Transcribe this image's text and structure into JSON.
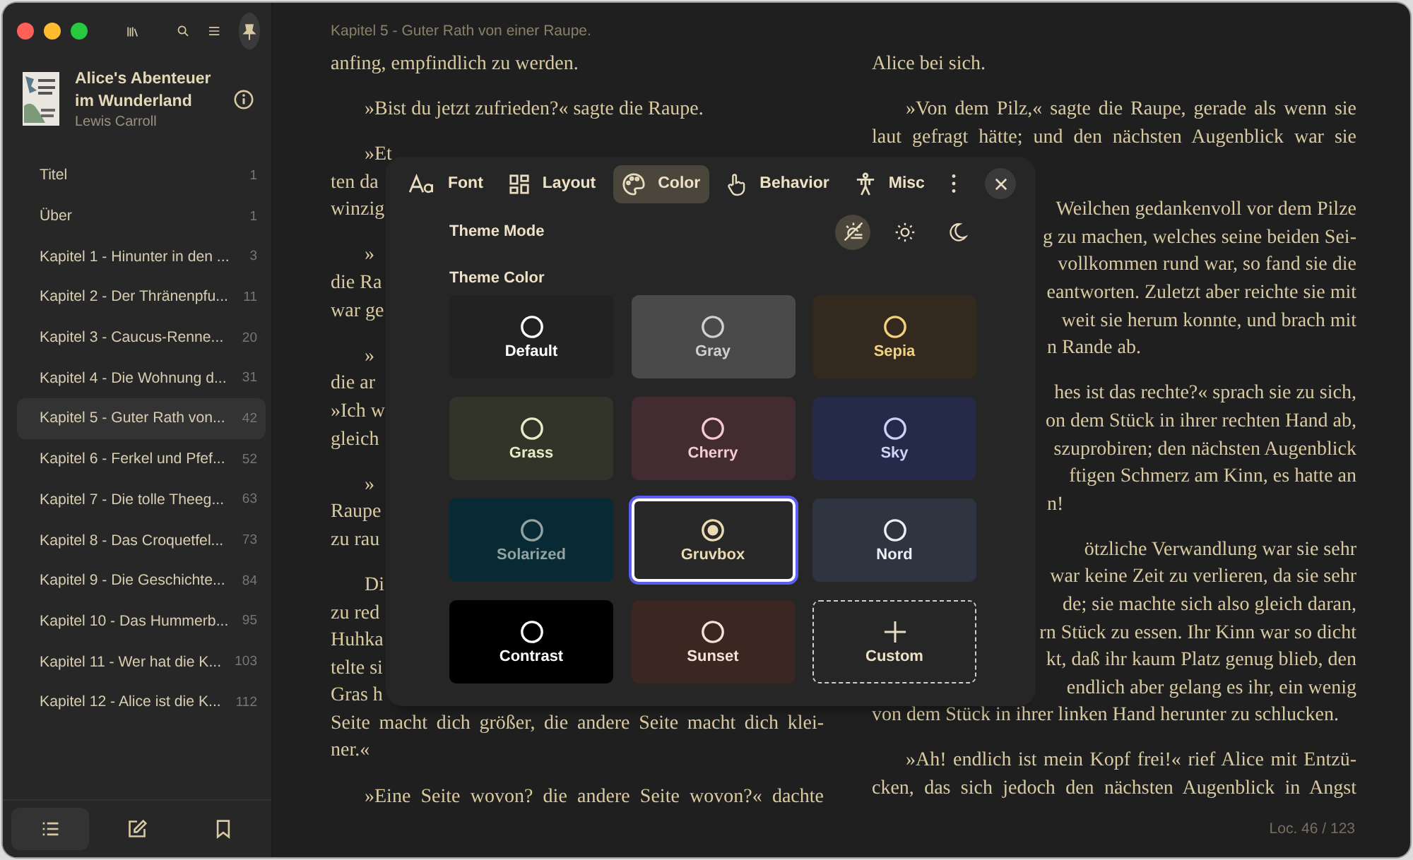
{
  "sidebar": {
    "pinned": true,
    "book": {
      "title": "Alice's Abenteuer im Wunderland",
      "author": "Lewis Carroll"
    },
    "toc": [
      {
        "label": "Titel",
        "page": "1",
        "selected": false
      },
      {
        "label": "Über",
        "page": "1",
        "selected": false
      },
      {
        "label": "Kapitel 1 - Hinunter in den ...",
        "page": "3",
        "selected": false
      },
      {
        "label": "Kapitel 2 - Der Thränenpfu...",
        "page": "11",
        "selected": false
      },
      {
        "label": "Kapitel 3 - Caucus-Renne...",
        "page": "20",
        "selected": false
      },
      {
        "label": "Kapitel 4 - Die Wohnung d...",
        "page": "31",
        "selected": false
      },
      {
        "label": "Kapitel 5 - Guter Rath von...",
        "page": "42",
        "selected": true
      },
      {
        "label": "Kapitel 6 - Ferkel und Pfef...",
        "page": "52",
        "selected": false
      },
      {
        "label": "Kapitel 7 - Die tolle Theeg...",
        "page": "63",
        "selected": false
      },
      {
        "label": "Kapitel 8 - Das Croquetfel...",
        "page": "73",
        "selected": false
      },
      {
        "label": "Kapitel 9 - Die Geschichte...",
        "page": "84",
        "selected": false
      },
      {
        "label": "Kapitel 10 - Das Hummerb...",
        "page": "95",
        "selected": false
      },
      {
        "label": "Kapitel 11 - Wer hat die K...",
        "page": "103",
        "selected": false
      },
      {
        "label": "Kapitel 12 - Alice ist die K...",
        "page": "112",
        "selected": false
      }
    ],
    "bottom_tabs": [
      {
        "kind": "toc",
        "selected": true
      },
      {
        "kind": "notes",
        "selected": false
      },
      {
        "kind": "bookmarks",
        "selected": false
      }
    ]
  },
  "reader": {
    "chapter": "Kapitel 5 - Guter Rath von einer Raupe.",
    "location": "Loc. 46 / 123",
    "columns": [
      {
        "paragraphs": [
          {
            "lines": [
              {
                "kind": "plain",
                "text": "anfing, empfindlich zu werden."
              }
            ]
          },
          {
            "lines": [
              {
                "kind": "indent",
                "text": "»Bist du jetzt zufrieden?« sagte die Raupe."
              }
            ]
          },
          {
            "lines": [
              {
                "kind": "indent",
                "text": "»Et"
              },
              {
                "kind": "plain",
                "text": "ten da"
              },
              {
                "kind": "plain",
                "text": "winzig"
              }
            ]
          },
          {
            "lines": [
              {
                "kind": "indent",
                "text": "»"
              },
              {
                "kind": "plain",
                "text": "die Ra"
              },
              {
                "kind": "plain",
                "text": "war ge"
              }
            ]
          },
          {
            "lines": [
              {
                "kind": "indent",
                "text": "»"
              },
              {
                "kind": "plain",
                "text": "die ar"
              },
              {
                "kind": "plain",
                "text": "»Ich w"
              },
              {
                "kind": "plain",
                "text": "gleich"
              }
            ]
          },
          {
            "lines": [
              {
                "kind": "indent",
                "text": "»"
              },
              {
                "kind": "plain",
                "text": "Raupe"
              },
              {
                "kind": "plain",
                "text": "zu rau"
              }
            ]
          },
          {
            "lines": [
              {
                "kind": "indent",
                "text": "Di"
              },
              {
                "kind": "plain",
                "text": "zu red"
              },
              {
                "kind": "plain",
                "text": "Huhka"
              },
              {
                "kind": "plain",
                "text": "telte si"
              },
              {
                "kind": "plain",
                "text": "Gras h"
              },
              {
                "kind": "justified",
                "text": "Seite macht dich größer, die andere Seite macht dich klei-"
              },
              {
                "kind": "plain",
                "text": "ner.«"
              }
            ]
          },
          {
            "lines": [
              {
                "kind": "indent_justified",
                "text": "»Eine Seite wovon? die andere Seite wovon?« dachte"
              }
            ]
          }
        ]
      },
      {
        "paragraphs": [
          {
            "lines": [
              {
                "kind": "plain",
                "text": "Alice bei sich."
              }
            ]
          },
          {
            "lines": [
              {
                "kind": "indent_justified",
                "text": "»Von dem Pilz,« sagte die Raupe, gerade als wenn sie"
              },
              {
                "kind": "justified",
                "text": "laut gefragt hätte; und den nächsten Augenblick war sie"
              }
            ]
          },
          {
            "lines": [
              {
                "kind": "right",
                "text": "Weilchen gedankenvoll vor dem Pilze"
              },
              {
                "kind": "right",
                "text": "g zu machen, welches seine beiden Sei-"
              },
              {
                "kind": "right",
                "text": "vollkommen rund war, so fand sie die"
              },
              {
                "kind": "right",
                "text": "eantworten. Zuletzt aber reichte sie mit"
              },
              {
                "kind": "right",
                "text": "weit sie herum konnte, und brach mit"
              },
              {
                "kind": "tail",
                "text": "n Rande ab."
              }
            ]
          },
          {
            "lines": [
              {
                "kind": "right",
                "text": "hes ist das rechte?« sprach sie zu sich,"
              },
              {
                "kind": "right",
                "text": "on dem Stück in ihrer rechten Hand ab,"
              },
              {
                "kind": "right",
                "text": "szuprobiren; den nächsten Augenblick"
              },
              {
                "kind": "right",
                "text": "ftigen Schmerz am Kinn, es hatte an"
              },
              {
                "kind": "tail",
                "text": "n!"
              }
            ]
          },
          {
            "lines": [
              {
                "kind": "right",
                "text": "ötzliche Verwandlung war sie sehr"
              },
              {
                "kind": "right",
                "text": "war keine Zeit zu verlieren, da sie sehr"
              },
              {
                "kind": "right",
                "text": "de; sie machte sich also gleich daran,"
              },
              {
                "kind": "right",
                "text": "rn Stück zu essen. Ihr Kinn war so dicht"
              },
              {
                "kind": "right",
                "text": "kt, daß ihr kaum Platz genug blieb, den"
              },
              {
                "kind": "right",
                "text": "endlich aber gelang es ihr, ein wenig"
              },
              {
                "kind": "plain",
                "text": "von dem Stück in ihrer linken Hand herunter zu schlucken."
              }
            ]
          },
          {
            "lines": [
              {
                "kind": "indent_justified",
                "text": "»Ah! endlich ist mein Kopf frei!« rief Alice mit Entzü-"
              },
              {
                "kind": "justified",
                "text": "cken, das sich jedoch den nächsten Augenblick in Angst"
              }
            ]
          }
        ]
      }
    ]
  },
  "settings": {
    "tabs": [
      {
        "kind": "font",
        "label": "Font",
        "selected": false
      },
      {
        "kind": "layout",
        "label": "Layout",
        "selected": false
      },
      {
        "kind": "color",
        "label": "Color",
        "selected": true
      },
      {
        "kind": "behavior",
        "label": "Behavior",
        "selected": false
      },
      {
        "kind": "misc",
        "label": "Misc",
        "selected": false
      }
    ],
    "theme_mode": {
      "label": "Theme Mode",
      "options": [
        {
          "kind": "auto",
          "selected": true
        },
        {
          "kind": "light",
          "selected": false
        },
        {
          "kind": "dark",
          "selected": false
        }
      ]
    },
    "theme_color": {
      "label": "Theme Color",
      "themes": [
        {
          "kind": "theme",
          "label": "Default",
          "background": {
            "color": "#222222"
          },
          "accent": {
            "color": "#ffffff"
          },
          "selected": false
        },
        {
          "kind": "theme",
          "label": "Gray",
          "background": {
            "color": "#4a4a4a"
          },
          "accent": {
            "color": "#d0d0d0"
          },
          "selected": false
        },
        {
          "kind": "theme",
          "label": "Sepia",
          "background": {
            "color": "#33291f"
          },
          "accent": {
            "color": "#f3d27e"
          },
          "selected": false
        },
        {
          "kind": "theme",
          "label": "Grass",
          "background": {
            "color": "#32342a"
          },
          "accent": {
            "color": "#e6ecc4"
          },
          "selected": false
        },
        {
          "kind": "theme",
          "label": "Cherry",
          "background": {
            "color": "#432c31"
          },
          "accent": {
            "color": "#f6cad3"
          },
          "selected": false
        },
        {
          "kind": "theme",
          "label": "Sky",
          "background": {
            "color": "#252a48"
          },
          "accent": {
            "color": "#cdd3f6"
          },
          "selected": false
        },
        {
          "kind": "theme",
          "label": "Solarized",
          "background": {
            "color": "#082a34"
          },
          "accent": {
            "color": "#93a1a1"
          },
          "selected": false
        },
        {
          "kind": "theme",
          "label": "Gruvbox",
          "background": {
            "color": "#282828"
          },
          "accent": {
            "color": "#ebdbb2"
          },
          "selected": true
        },
        {
          "kind": "theme",
          "label": "Nord",
          "background": {
            "color": "#2e3440"
          },
          "accent": {
            "color": "#eceff4"
          },
          "selected": false
        },
        {
          "kind": "theme",
          "label": "Contrast",
          "background": {
            "color": "#000000"
          },
          "accent": {
            "color": "#ffffff"
          },
          "selected": false
        },
        {
          "kind": "theme",
          "label": "Sunset",
          "background": {
            "color": "#3a2722"
          },
          "accent": {
            "color": "#f6e2d6"
          },
          "selected": false
        },
        {
          "kind": "custom",
          "label": "Custom",
          "selected": false
        }
      ]
    }
  }
}
